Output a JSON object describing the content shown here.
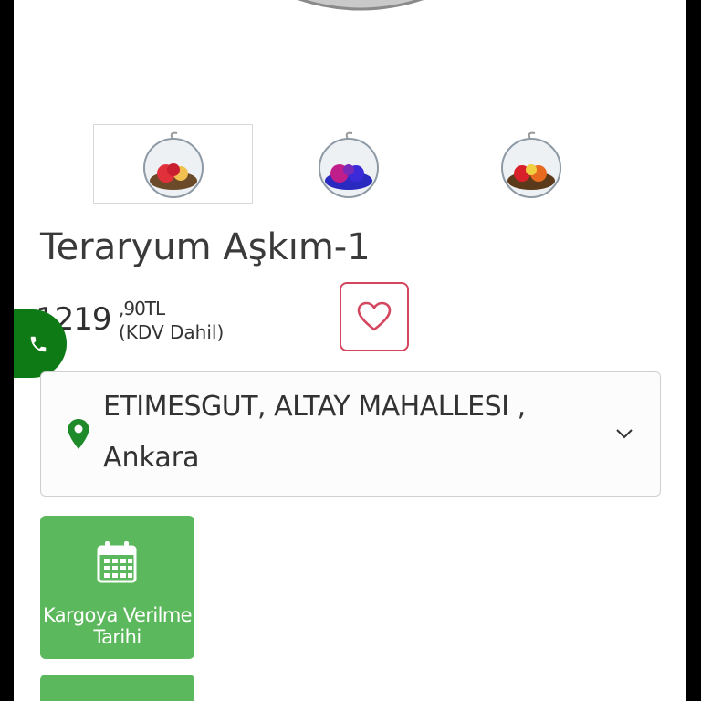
{
  "product": {
    "title": "Teraryum Aşkım-1",
    "price_main": "1219",
    "price_fraction": ",90TL",
    "price_vat_note": "(KDV Dahil)"
  },
  "thumbnails": [
    {
      "name": "thumb-red",
      "rose_color": "#e0303a",
      "active": true
    },
    {
      "name": "thumb-blue",
      "rose_color": "#3a2ad8",
      "active": false
    },
    {
      "name": "thumb-mixed",
      "rose_color": "#e86a20",
      "active": false
    }
  ],
  "location": {
    "line1": "ETIMESGUT, ALTAY MAHALLESI ,",
    "line2": "Ankara",
    "icon": "map-pin-icon"
  },
  "delivery": {
    "date_label_line1": "Kargoya Verilme",
    "date_label_line2": "Tarihi",
    "icon": "calendar-icon"
  },
  "colors": {
    "accent_green": "#5cb85c",
    "phone_green": "#0e7a15",
    "fav_red": "#d4455e",
    "pin_green": "#1e8a2a"
  }
}
